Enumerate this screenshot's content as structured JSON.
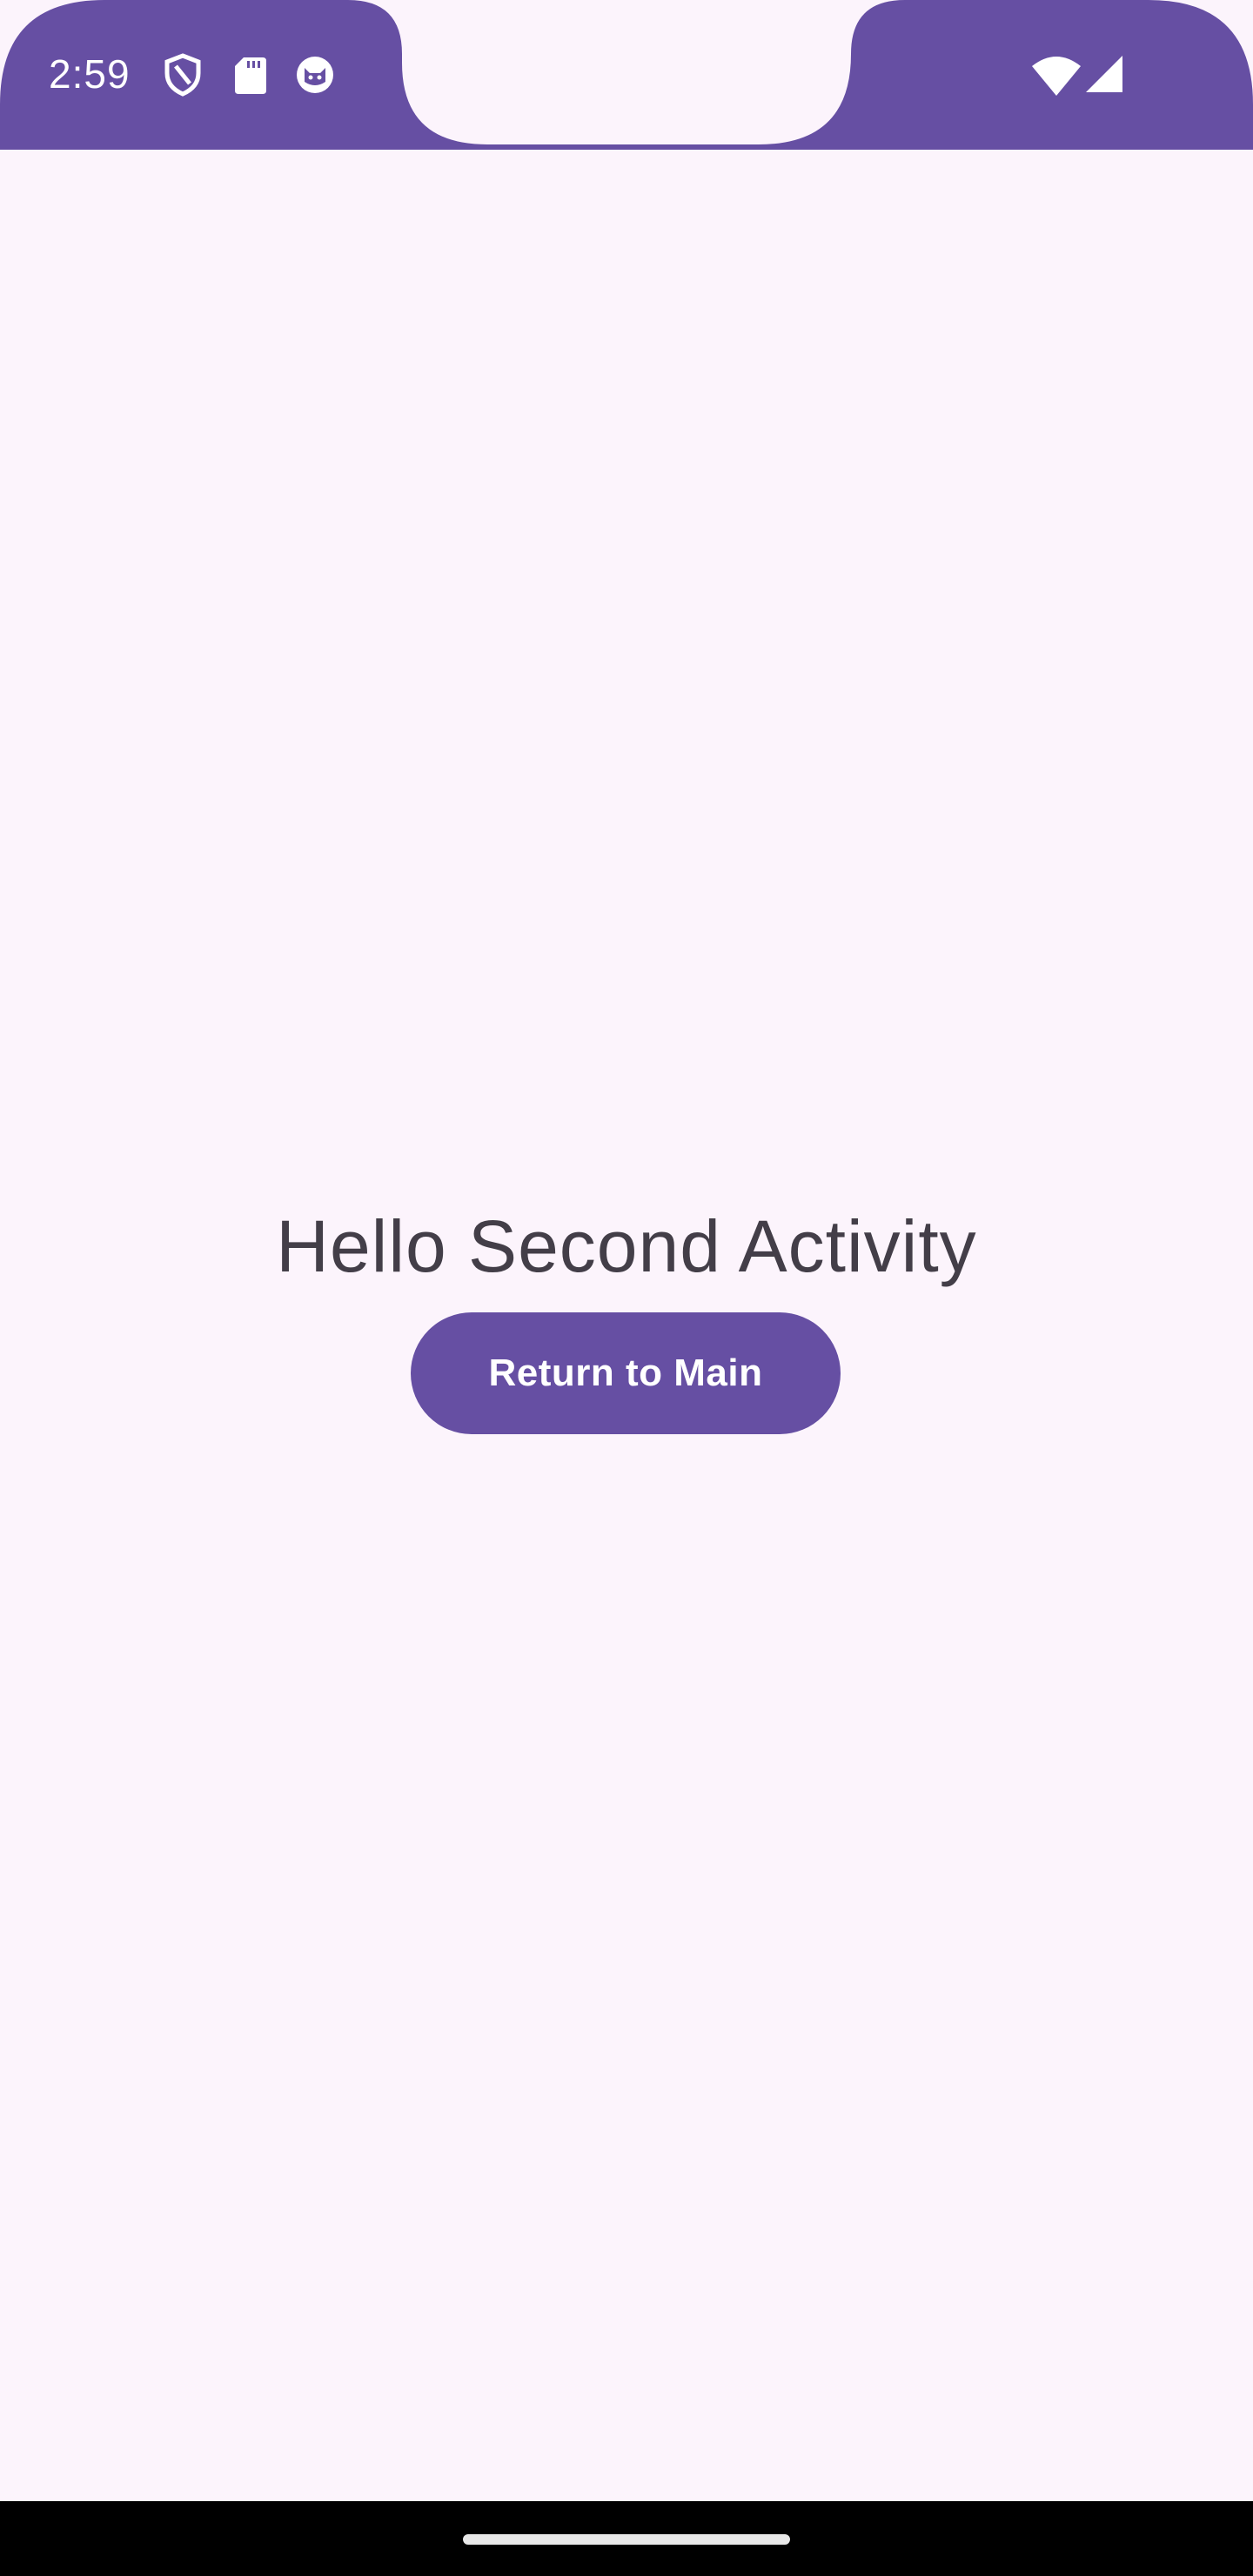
{
  "theme": {
    "primary": "#664FA3",
    "background": "#FCF4FC",
    "text": "#433E48",
    "on_primary": "#FFFFFF",
    "nav_bar": "#000000"
  },
  "status_bar": {
    "time": "2:59",
    "left_icons": [
      "shield-icon",
      "sd-card-icon",
      "cat-face-icon"
    ],
    "right_icons": [
      "wifi-icon",
      "cell-signal-icon"
    ]
  },
  "main": {
    "heading": "Hello Second Activity",
    "button_label": "Return to Main"
  }
}
